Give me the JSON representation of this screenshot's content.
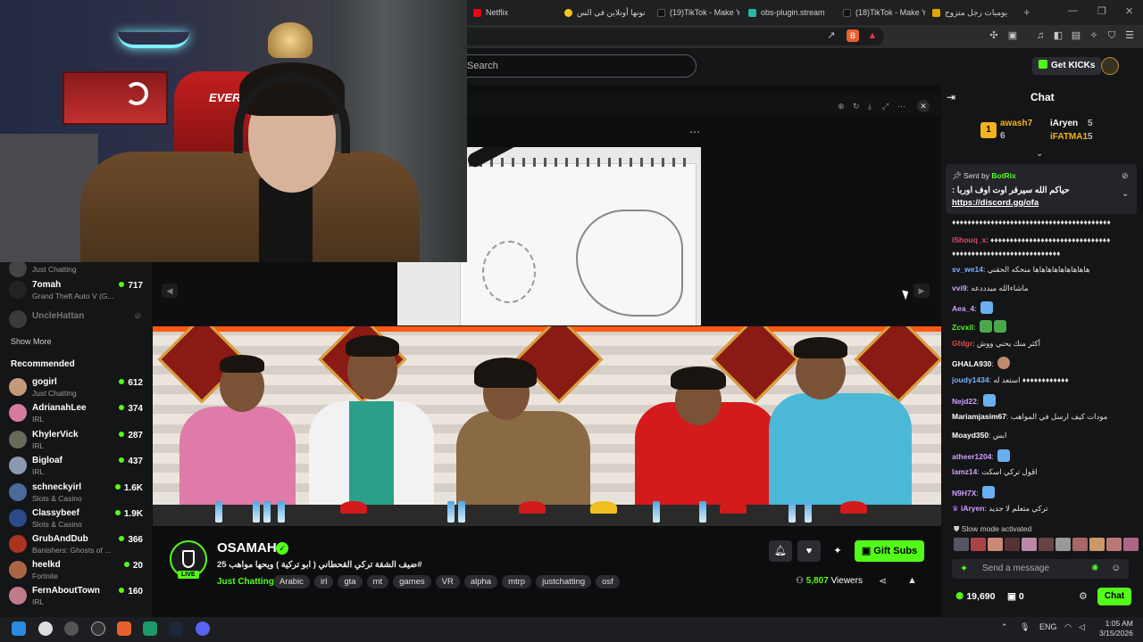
{
  "browser": {
    "tabs": [
      {
        "label": "Netflix",
        "color": "#e50914"
      },
      {
        "label": "نونها أونلاين في الس",
        "color": "#f5c518"
      },
      {
        "label": "(19)TikTok - Make Y",
        "color": "#111111"
      },
      {
        "label": "obs-plugin.stream",
        "color": "#2fb5a4"
      },
      {
        "label": "(18)TikTok - Make Y",
        "color": "#111111"
      },
      {
        "label": "يوميات رجل متزوج",
        "color": "#e0a800"
      }
    ],
    "new_tab": "+"
  },
  "header": {
    "search_placeholder": "Search",
    "get_kicks": "Get KICKs"
  },
  "sidebar": {
    "followed": [
      {
        "name": "",
        "sub": "Just Chatting",
        "count": ""
      },
      {
        "name": "7omah",
        "sub": "Grand Theft Auto V (G...",
        "count": "717"
      },
      {
        "name": "UncleHattan",
        "sub": "",
        "count": ""
      }
    ],
    "show_more": "Show More",
    "recommended_heading": "Recommended",
    "recommended": [
      {
        "name": "gogirl",
        "sub": "Just Chatting",
        "count": "612",
        "color": "#c49a7a"
      },
      {
        "name": "AdrianahLee",
        "sub": "IRL",
        "count": "374",
        "color": "#d67aa0"
      },
      {
        "name": "KhylerVick",
        "sub": "IRL",
        "count": "287",
        "color": "#6a6a5a"
      },
      {
        "name": "Bigloaf",
        "sub": "IRL",
        "count": "437",
        "color": "#8a9ab0"
      },
      {
        "name": "schneckyirl",
        "sub": "Slots & Casino",
        "count": "1.6K",
        "color": "#4a6a9a"
      },
      {
        "name": "Classybeef",
        "sub": "Slots & Casino",
        "count": "1.9K",
        "color": "#2a4a8a"
      },
      {
        "name": "GrubAndDub",
        "sub": "Banishers: Ghosts of ...",
        "count": "366",
        "color": "#aa3322"
      },
      {
        "name": "heelkd",
        "sub": "Fortnite",
        "count": "20",
        "color": "#aa6644"
      },
      {
        "name": "FernAboutTown",
        "sub": "IRL",
        "count": "160",
        "color": "#c07a8a"
      }
    ]
  },
  "stream": {
    "channel": "OSAMAH",
    "live": "LIVE",
    "title": "ضيف الشقة تركي القحطاني ( ابو تركية ) ويحها مواهب 25#",
    "category": "Just Chatting",
    "tags": [
      "Arabic",
      "irl",
      "gta",
      "mt",
      "games",
      "VR",
      "alpha",
      "mtrp",
      "justchatting",
      "osf"
    ],
    "gift_subs": "Gift Subs",
    "viewers_count": "5,807",
    "viewers_label": "Viewers"
  },
  "chat": {
    "title": "Chat",
    "leaderboard": [
      {
        "name": "awash7",
        "value": "6",
        "color": "#f2b31d"
      },
      {
        "name": "iAryen",
        "value": "5",
        "color": "#ffffff"
      },
      {
        "name": "iFATMA1",
        "value": "5",
        "color": "#f2b31d"
      }
    ],
    "pinned": {
      "sent_by_label": "Sent by",
      "sender": "BotRix",
      "text": "حياكم الله سيرفر اوت اوف اوربا :",
      "link": "https://discord.gg/ofa"
    },
    "messages": [
      {
        "user": "",
        "text": "♦♦♦♦♦♦♦♦♦♦♦♦♦♦♦♦♦♦♦♦♦♦♦♦♦♦♦♦♦♦♦♦♦♦♦♦♦♦♦♦♦",
        "color": "#ffffff"
      },
      {
        "user": "lShouq_x",
        "text": "♦♦♦♦♦♦♦♦♦♦♦♦♦♦♦♦♦♦♦♦♦♦♦♦♦♦♦♦♦♦♦",
        "color": "#e04a6a"
      },
      {
        "user": "",
        "text": "♦♦♦♦♦♦♦♦♦♦♦♦♦♦♦♦♦♦♦♦♦♦♦♦♦♦♦♦",
        "color": "#ffffff"
      },
      {
        "user": "sv_we14",
        "text": "هاهاهاهاهاهاهاهاها منحكه الحقني",
        "color": "#7ab0ff"
      },
      {
        "user": "vvi9",
        "text": "ماشاءالله مبدددعه",
        "color": "#d0a0ff"
      },
      {
        "user": "Aea_4",
        "text": "",
        "color": "#d0a0ff"
      },
      {
        "user": "Zcvxil",
        "text": "",
        "color": "#53fc18"
      },
      {
        "user": "Gfdgr",
        "text": "أكثر منك يحني ووش",
        "color": "#e04a4a"
      },
      {
        "user": "GHALA930",
        "text": "",
        "color": "#ffffff"
      },
      {
        "user": "joudy1434",
        "text": "استعد له ♦♦♦♦♦♦♦♦♦♦♦♦",
        "color": "#7ab0ff"
      },
      {
        "user": "Nejd22",
        "text": "",
        "color": "#d0a0ff"
      },
      {
        "user": "Mariamjasim67",
        "text": "مودات كيف ارسل في المواهب",
        "color": "#ffffff"
      },
      {
        "user": "Moayd350",
        "text": "ابس",
        "color": "#ffffff"
      },
      {
        "user": "atheer1204",
        "text": "",
        "color": "#d0a0ff"
      },
      {
        "user": "lamz14",
        "text": "اقول تركي اسكت",
        "color": "#d0a0ff"
      },
      {
        "user": "N9H7X",
        "text": "",
        "color": "#d0a0ff"
      },
      {
        "user": "iAryen",
        "text": "تركي متعلم لا جديد",
        "color": "#d0a0ff"
      }
    ],
    "slow_mode": "Slow mode activated",
    "send_placeholder": "Send a message",
    "kicks_balance": "19,690",
    "gifts_count": "0",
    "chat_button": "Chat"
  },
  "taskbar": {
    "lang": "ENG",
    "time": "1:05 AM",
    "date": "3/15/2026"
  }
}
